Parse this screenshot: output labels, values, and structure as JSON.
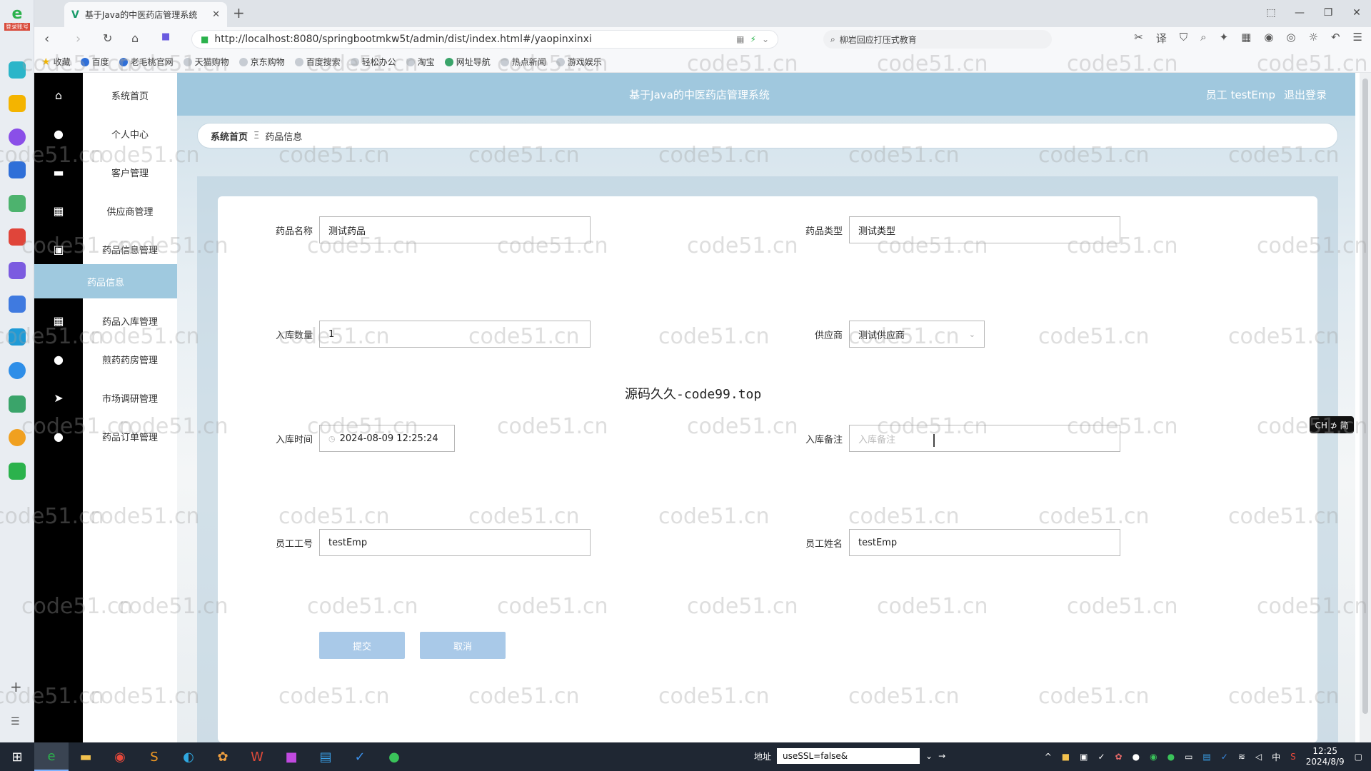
{
  "browser": {
    "tab_title": "基于Java的中医药店管理系统",
    "url": "http://localhost:8080/springbootmkw5t/admin/dist/index.html#/yaopinxinxi",
    "search_text": "柳岩回应打压式教育",
    "login_badge": "登录账号",
    "bookmarks": [
      "收藏",
      "百度",
      "老毛桃官网",
      "天猫购物",
      "京东购物",
      "百度搜索",
      "轻松办公",
      "淘宝",
      "网址导航",
      "热点新闻",
      "游戏娱乐"
    ]
  },
  "app": {
    "system_title": "基于Java的中医药店管理系统",
    "user_label": "员工 testEmp",
    "logout": "退出登录"
  },
  "menu": {
    "items": [
      "系统首页",
      "个人中心",
      "客户管理",
      "供应商管理",
      "药品信息管理",
      "药品入库管理",
      "煎药药房管理",
      "市场调研管理",
      "药品订单管理"
    ],
    "active": "药品信息"
  },
  "breadcrumb": {
    "home": "系统首页",
    "sep": "Ξ",
    "current": "药品信息"
  },
  "form": {
    "drug_name_label": "药品名称",
    "drug_name": "测试药品",
    "drug_type_label": "药品类型",
    "drug_type": "测试类型",
    "quantity_label": "入库数量",
    "quantity": "1",
    "supplier_label": "供应商",
    "supplier": "测试供应商",
    "time_label": "入库时间",
    "time": "2024-08-09 12:25:24",
    "remark_label": "入库备注",
    "remark_placeholder": "入库备注",
    "emp_no_label": "员工工号",
    "emp_no": "testEmp",
    "emp_name_label": "员工姓名",
    "emp_name": "testEmp",
    "submit": "提交",
    "cancel": "取消"
  },
  "overlay_text": "源码久久-code99.top",
  "ime_badge": "CH ⊅ 简",
  "watermark": "code51.cn",
  "taskbar": {
    "addr_label": "地址",
    "addr_value": "useSSL=false&",
    "time": "12:25",
    "date": "2024/8/9"
  }
}
